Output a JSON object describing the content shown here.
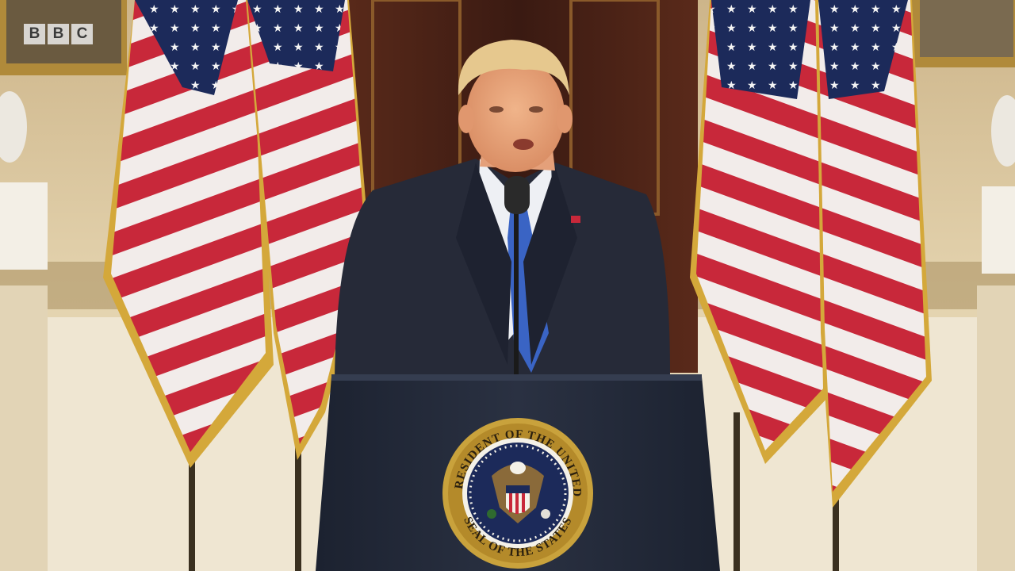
{
  "broadcaster": {
    "letters": [
      "B",
      "B",
      "C"
    ]
  },
  "podium": {
    "seal_text_top": "PRESIDENT OF THE UNITED",
    "seal_text_bottom": "SEAL OF THE STATES"
  },
  "colors": {
    "wall": "#d9c7a4",
    "wall_shadow": "#b49a72",
    "door": "#4a2418",
    "flag_red": "#c8283a",
    "flag_white": "#f2ecea",
    "flag_blue": "#1c2a5a",
    "flag_fringe": "#d4a83a",
    "suit": "#262a38",
    "tie": "#3a64c4",
    "podium": "#232a3a",
    "seal_gold": "#c9a23c"
  }
}
